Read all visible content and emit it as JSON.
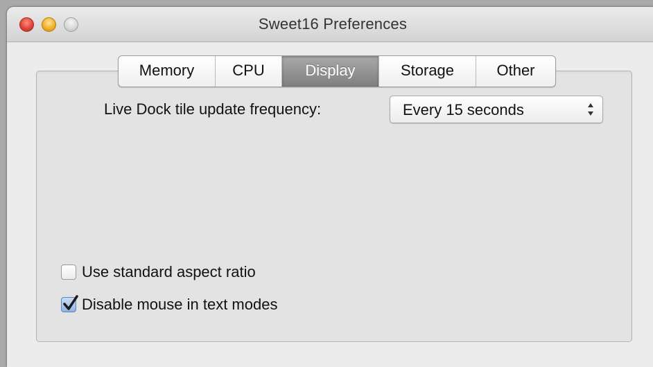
{
  "window": {
    "title": "Sweet16 Preferences"
  },
  "tabs": [
    {
      "label": "Memory",
      "selected": false
    },
    {
      "label": "CPU",
      "selected": false
    },
    {
      "label": "Display",
      "selected": true
    },
    {
      "label": "Storage",
      "selected": false
    },
    {
      "label": "Other",
      "selected": false
    }
  ],
  "display": {
    "dock_tile_label": "Live Dock tile update frequency:",
    "dock_tile_value": "Every 15 seconds",
    "checkboxes": [
      {
        "label": "Use standard aspect ratio",
        "checked": false
      },
      {
        "label": "Disable mouse in text modes",
        "checked": true
      }
    ]
  },
  "colors": {
    "selected_tab": "#8f8f8f",
    "checkbox_accent": "#5d86bd",
    "close_button": "#e0443a",
    "minimize_button": "#f4b02a"
  }
}
